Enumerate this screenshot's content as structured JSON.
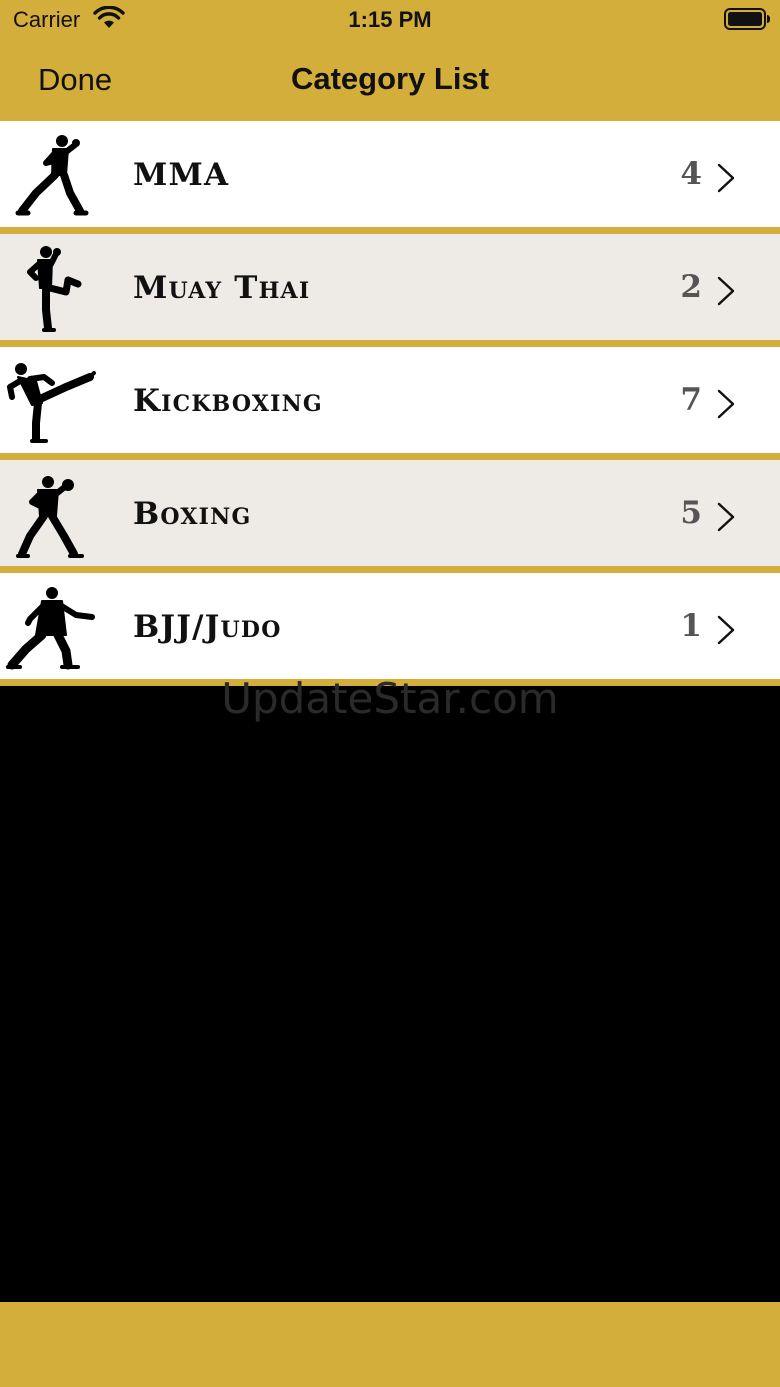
{
  "status_bar": {
    "carrier": "Carrier",
    "time": "1:15 PM",
    "wifi_icon": "wifi-icon",
    "battery_icon": "battery-icon"
  },
  "nav": {
    "done_label": "Done",
    "title": "Category List"
  },
  "categories": [
    {
      "label": "MMA",
      "count": "4",
      "icon": "mma-fighter-icon"
    },
    {
      "label": "Muay Thai",
      "count": "2",
      "icon": "muay-thai-fighter-icon"
    },
    {
      "label": "Kickboxing",
      "count": "7",
      "icon": "kickboxing-fighter-icon"
    },
    {
      "label": "Boxing",
      "count": "5",
      "icon": "boxer-icon"
    },
    {
      "label": "BJJ/Judo",
      "count": "1",
      "icon": "judo-fighter-icon"
    }
  ],
  "watermark": "UpdateStar.com",
  "colors": {
    "accent": "#d4ae3a",
    "row_light": "#ffffff",
    "row_alt": "#eeebe7",
    "background": "#000000"
  }
}
